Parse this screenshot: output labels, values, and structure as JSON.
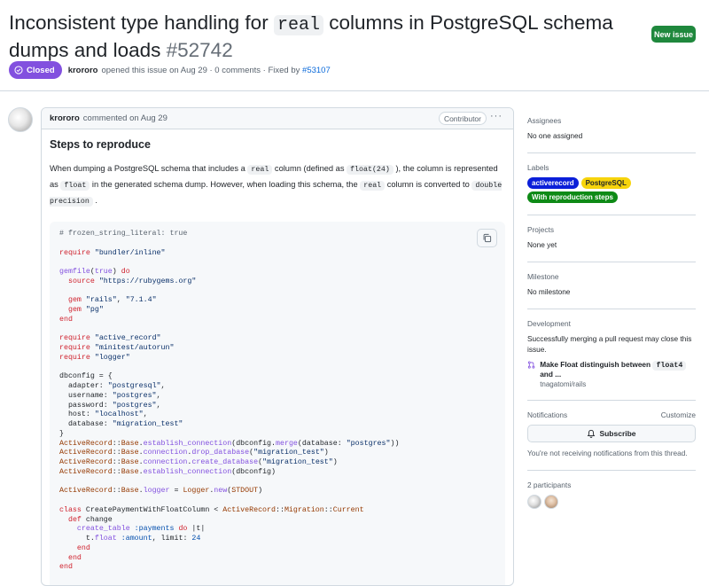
{
  "issue": {
    "title_before": "Inconsistent type handling for ",
    "title_code": "real",
    "title_after": " columns in PostgreSQL schema dumps and loads ",
    "number": "#52742",
    "new_issue_label": "New issue",
    "state_label": "Closed",
    "author": "krororo",
    "opened_text": "opened this issue on Aug 29 · 0 comments · Fixed by",
    "fixed_by": "#53107"
  },
  "comment": {
    "author": "krororo",
    "commented_text": "commented on Aug 29",
    "role_badge": "Contributor",
    "menu_label": "···",
    "heading": "Steps to reproduce",
    "p1": "When dumping a PostgreSQL schema that includes a ",
    "c1": "real",
    "p2": " column (defined as ",
    "c2": "float(24)",
    "p3": " ), the column is represented as ",
    "c3": "float",
    "p4": " in the generated schema dump. However, when loading this schema, the ",
    "c4": "real",
    "p5": " column is converted to ",
    "c5": "double precision",
    "p6": " ."
  },
  "code_lines": [
    "# frozen_string_literal: true",
    "",
    "require \"bundler/inline\"",
    "",
    "gemfile(true) do",
    "  source \"https://rubygems.org\"",
    "",
    "  gem \"rails\", \"7.1.4\"",
    "  gem \"pg\"",
    "end",
    "",
    "require \"active_record\"",
    "require \"minitest/autorun\"",
    "require \"logger\"",
    "",
    "dbconfig = {",
    "  adapter: \"postgresql\",",
    "  username: \"postgres\",",
    "  password: \"postgres\",",
    "  host: \"localhost\",",
    "  database: \"migration_test\"",
    "}",
    "ActiveRecord::Base.establish_connection(dbconfig.merge(database: \"postgres\"))",
    "ActiveRecord::Base.connection.drop_database(\"migration_test\")",
    "ActiveRecord::Base.connection.create_database(\"migration_test\")",
    "ActiveRecord::Base.establish_connection(dbconfig)",
    "",
    "ActiveRecord::Base.logger = Logger.new(STDOUT)",
    "",
    "class CreatePaymentWithFloatColumn < ActiveRecord::Migration::Current",
    "  def change",
    "    create_table :payments do |t|",
    "      t.float :amount, limit: 24",
    "    end",
    "  end",
    "end"
  ],
  "sidebar": {
    "assignees": {
      "heading": "Assignees",
      "value": "No one assigned"
    },
    "labels": {
      "heading": "Labels",
      "items": [
        {
          "name": "activerecord",
          "bg": "#0b1fd9",
          "fg": "#ffffff"
        },
        {
          "name": "PostgreSQL",
          "bg": "#f7d40c",
          "fg": "#1f2328"
        },
        {
          "name": "With reproduction steps",
          "bg": "#0e8a16",
          "fg": "#ffffff"
        }
      ]
    },
    "projects": {
      "heading": "Projects",
      "value": "None yet"
    },
    "milestone": {
      "heading": "Milestone",
      "value": "No milestone"
    },
    "development": {
      "heading": "Development",
      "value": "Successfully merging a pull request may close this issue.",
      "pr_title_before": "Make Float distinguish between ",
      "pr_title_code": "float4",
      "pr_title_after": " and ...",
      "pr_repo": "tnagatomi/rails"
    },
    "notifications": {
      "heading": "Notifications",
      "customize": "Customize",
      "button": "Subscribe",
      "note": "You're not receiving notifications from this thread."
    },
    "participants": {
      "heading": "2 participants"
    }
  },
  "colors": {
    "closed": "#8250df",
    "new_issue": "#1f883d",
    "link": "#0969da"
  }
}
